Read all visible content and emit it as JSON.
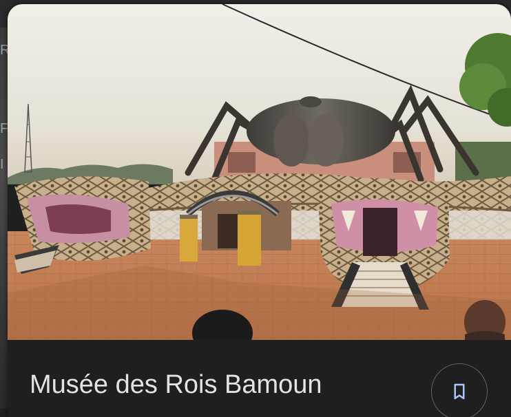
{
  "place": {
    "title": "Musée des Rois Bamoun"
  },
  "actions": {
    "save_icon": "bookmark-icon"
  },
  "backdrop": {
    "glyphs": [
      "R",
      "F",
      "I"
    ]
  },
  "colors": {
    "card_background": "#1f1f1f",
    "title_text": "#e3e3e3",
    "icon_accent": "#a8c7fa",
    "button_border": "#5f6368"
  }
}
